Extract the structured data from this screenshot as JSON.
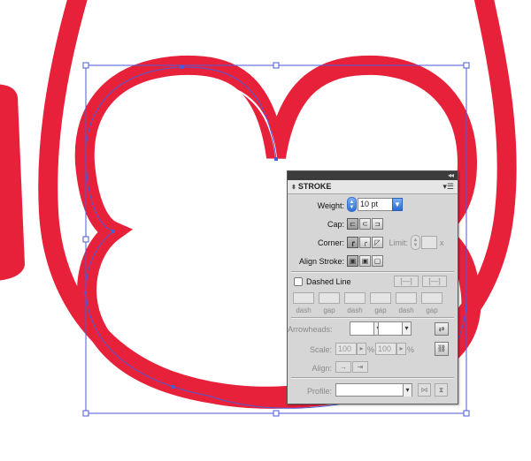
{
  "panel": {
    "title": "STROKE",
    "weight": {
      "label": "Weight:",
      "value": "10 pt"
    },
    "cap": {
      "label": "Cap:"
    },
    "corner": {
      "label": "Corner:",
      "limit_label": "Limit:",
      "limit_suffix": "x"
    },
    "align_stroke": {
      "label": "Align Stroke:"
    },
    "dashed_line": {
      "label": "Dashed Line",
      "checked": false
    },
    "dash_gap_labels": [
      "dash",
      "gap",
      "dash",
      "gap",
      "dash",
      "gap"
    ],
    "arrowheads": {
      "label": "Arrowheads:"
    },
    "scale": {
      "label": "Scale:",
      "start": "100",
      "end": "100",
      "unit1": "%",
      "unit2": "%"
    },
    "align": {
      "label": "Align:"
    },
    "profile": {
      "label": "Profile:"
    }
  },
  "icons": {
    "collapse": "double-chevron-left-icon",
    "menu": "panel-menu-icon"
  },
  "colors": {
    "artwork_red": "#e8213b",
    "selection_blue": "#4a5bd6",
    "panel_bg": "#d6d6d6"
  }
}
